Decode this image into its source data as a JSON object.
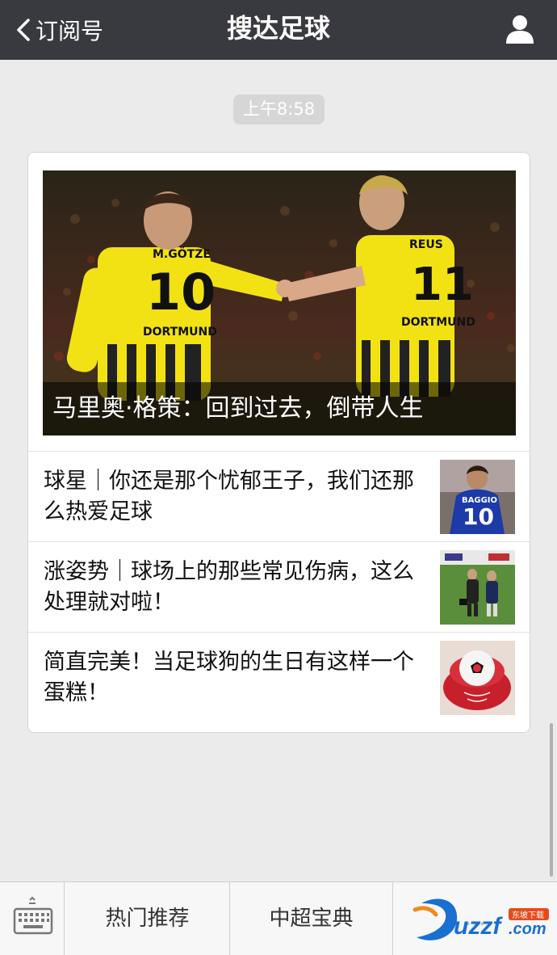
{
  "nav": {
    "back_label": "订阅号",
    "title": "搜达足球"
  },
  "timestamp": "上午8:58",
  "hero": {
    "caption": "马里奥·格策：回到过去，倒带人生",
    "jersey_left_name": "M.GÖTZE",
    "jersey_left_number": "10",
    "jersey_left_club": "DORTMUND",
    "jersey_right_name": "REUS",
    "jersey_right_number": "11",
    "jersey_right_club": "DORTMUND"
  },
  "articles": [
    {
      "title": "球星｜你还是那个忧郁王子，我们还那么热爱足球",
      "thumb_number": "10",
      "thumb_name": "BAGGIO"
    },
    {
      "title": "涨姿势｜球场上的那些常见伤病，这么处理就对啦！"
    },
    {
      "title": "简直完美！当足球狗的生日有这样一个蛋糕！"
    }
  ],
  "menu": {
    "item1": "热门推荐",
    "item2": "中超宝典",
    "item3": "…"
  },
  "watermark": {
    "brand": "uzzf",
    "suffix": ".com",
    "tag": "东坡下载"
  },
  "colors": {
    "topbar": "#393a3f",
    "background": "#ebebeb",
    "jersey_yellow": "#f2e213"
  }
}
